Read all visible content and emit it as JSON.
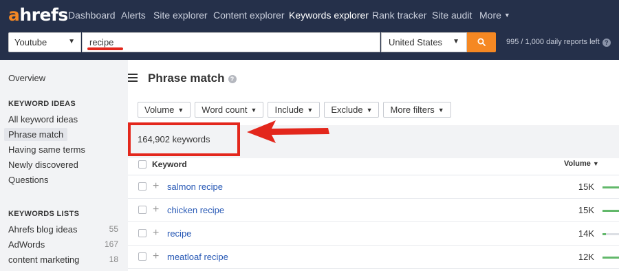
{
  "brand": {
    "logo_a": "a",
    "logo_rest": "hrefs",
    "accent": "#f58823"
  },
  "nav": {
    "items": [
      {
        "label": "Dashboard"
      },
      {
        "label": "Alerts"
      },
      {
        "label": "Site explorer"
      },
      {
        "label": "Content explorer"
      },
      {
        "label": "Keywords explorer"
      },
      {
        "label": "Rank tracker"
      },
      {
        "label": "Site audit"
      },
      {
        "label": "More"
      }
    ],
    "active": "Keywords explorer"
  },
  "search": {
    "mode": "Youtube",
    "query": "recipe",
    "country": "United States",
    "button_icon": "search-icon",
    "reports_left": "995 / 1,000 daily reports left"
  },
  "sidebar": {
    "overview": "Overview",
    "ideas_heading": "KEYWORD IDEAS",
    "ideas": [
      {
        "label": "All keyword ideas"
      },
      {
        "label": "Phrase match"
      },
      {
        "label": "Having same terms"
      },
      {
        "label": "Newly discovered"
      },
      {
        "label": "Questions"
      }
    ],
    "lists_heading": "KEYWORDS LISTS",
    "lists": [
      {
        "label": "Ahrefs blog ideas",
        "count": "55"
      },
      {
        "label": "AdWords",
        "count": "167"
      },
      {
        "label": "content marketing",
        "count": "18"
      }
    ]
  },
  "main": {
    "title": "Phrase match",
    "filters": [
      {
        "label": "Volume"
      },
      {
        "label": "Word count"
      },
      {
        "label": "Include"
      },
      {
        "label": "Exclude"
      },
      {
        "label": "More filters"
      }
    ],
    "count_text": "164,902 keywords",
    "columns": {
      "keyword": "Keyword",
      "volume": "Volume"
    },
    "rows": [
      {
        "keyword": "salmon recipe",
        "volume": "15K",
        "bar": 1.0
      },
      {
        "keyword": "chicken recipe",
        "volume": "15K",
        "bar": 1.0
      },
      {
        "keyword": "recipe",
        "volume": "14K",
        "bar": 0.2
      },
      {
        "keyword": "meatloaf recipe",
        "volume": "12K",
        "bar": 1.0
      }
    ]
  },
  "colors": {
    "nav_bg": "#25304a",
    "highlight_red": "#e3271c",
    "link_blue": "#2758b5",
    "bar_green": "#62b86a"
  }
}
